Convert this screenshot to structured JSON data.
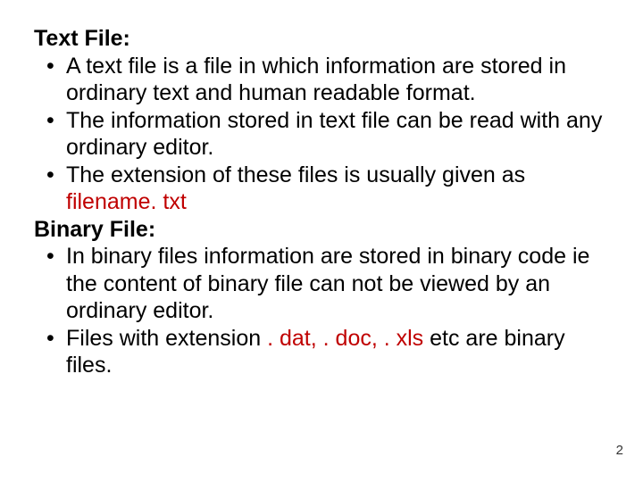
{
  "section1": {
    "heading": "Text File:",
    "items": [
      {
        "text": "A text file is a file in which information are stored in ordinary text and human readable format."
      },
      {
        "text": "The information stored in text file can be read with any ordinary editor."
      },
      {
        "prefix": "The extension of these files is usually given as ",
        "redText": "filename. txt"
      }
    ]
  },
  "section2": {
    "heading": "Binary File:",
    "items": [
      {
        "text": "In binary files information are stored in binary code ie the content of binary file can not be viewed by an ordinary editor."
      },
      {
        "prefix": "Files with extension ",
        "redText": ". dat, . doc, . xls",
        "suffix": " etc are binary files."
      }
    ]
  },
  "pageNumber": "2"
}
